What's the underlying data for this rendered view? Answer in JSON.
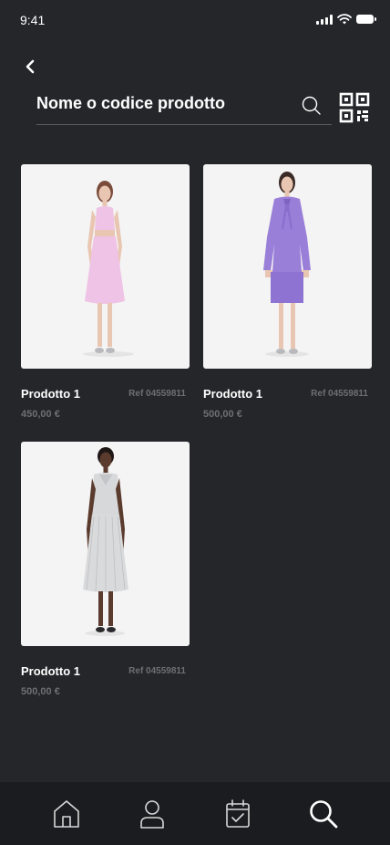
{
  "status": {
    "time": "9:41"
  },
  "search": {
    "placeholder": "Nome o codice prodotto"
  },
  "products": [
    {
      "name": "Prodotto 1",
      "ref": "Ref 04559811",
      "price": "450,00 €",
      "dress_color": "#f0c8e8"
    },
    {
      "name": "Prodotto 1",
      "ref": "Ref 04559811",
      "price": "500,00 €",
      "dress_color": "#9b7fd9"
    },
    {
      "name": "Prodotto 1",
      "ref": "Ref 04559811",
      "price": "500,00 €",
      "dress_color": "#d9dadb"
    }
  ],
  "nav": [
    "home-icon",
    "user-icon",
    "calendar-check-icon",
    "search-icon"
  ],
  "colors": {
    "background": "#25262a",
    "nav_background": "#1b1c1f",
    "muted_text": "#6e6f74"
  }
}
